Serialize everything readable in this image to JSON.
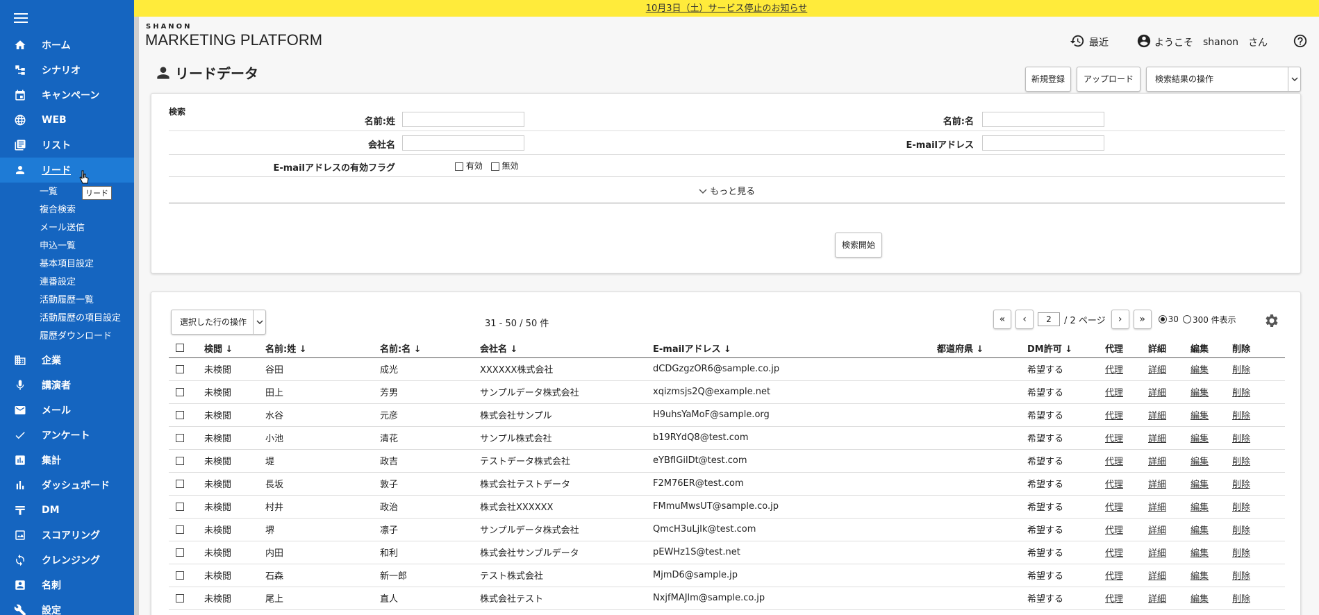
{
  "notice": {
    "text": "10月3日（土）サービス停止のお知らせ"
  },
  "logo": {
    "top": "SHANON",
    "main": "MARKETING PLATFORM"
  },
  "header": {
    "recent": "最近",
    "welcome": "ようこそ",
    "user": "shanon",
    "honorific": "さん"
  },
  "sidebar": {
    "items": [
      {
        "label": "ホーム",
        "icon": "home-icon"
      },
      {
        "label": "シナリオ",
        "icon": "scenario-icon"
      },
      {
        "label": "キャンペーン",
        "icon": "calendar-icon"
      },
      {
        "label": "WEB",
        "icon": "globe-icon"
      },
      {
        "label": "リスト",
        "icon": "list-icon"
      },
      {
        "label": "リード",
        "icon": "person-icon"
      }
    ],
    "sub_items": [
      "一覧",
      "複合検索",
      "メール送信",
      "申込一覧",
      "基本項目設定",
      "連番設定",
      "活動履歴一覧",
      "活動履歴の項目設定",
      "履歴ダウンロード"
    ],
    "items_after": [
      {
        "label": "企業",
        "icon": "building-icon"
      },
      {
        "label": "講演者",
        "icon": "microphone-icon"
      },
      {
        "label": "メール",
        "icon": "mail-icon"
      },
      {
        "label": "アンケート",
        "icon": "check-icon"
      },
      {
        "label": "集計",
        "icon": "report-icon"
      },
      {
        "label": "ダッシュボード",
        "icon": "bar-chart-icon"
      },
      {
        "label": "DM",
        "icon": "dm-icon"
      },
      {
        "label": "スコアリング",
        "icon": "scoring-icon"
      },
      {
        "label": "クレンジング",
        "icon": "cleansing-icon"
      },
      {
        "label": "名刺",
        "icon": "card-icon"
      },
      {
        "label": "設定",
        "icon": "wrench-icon"
      }
    ],
    "tooltip": "リード"
  },
  "page": {
    "title": "リードデータ",
    "new_button": "新規登録",
    "upload_button": "アップロード",
    "results_op": "検索結果の操作"
  },
  "search": {
    "label": "検索",
    "last_name": "名前:姓",
    "first_name": "名前:名",
    "company": "会社名",
    "email": "E-mailアドレス",
    "email_flag": "E-mailアドレスの有効フラグ",
    "valid": "有効",
    "invalid": "無効",
    "more": "もっと見る",
    "submit": "検索開始"
  },
  "results": {
    "rows_op": "選択した行の操作",
    "count": "31 - 50 / 50 件",
    "page_current": "2",
    "page_total": "/ 2 ページ",
    "per_page_30": "30",
    "per_page_300": "300 件表示",
    "columns": [
      "検閲 ↓",
      "名前:姓 ↓",
      "名前:名 ↓",
      "会社名 ↓",
      "E-mailアドレス ↓",
      "都道府県 ↓",
      "DM許可 ↓",
      "代理",
      "詳細",
      "編集",
      "削除"
    ],
    "action_labels": [
      "代理",
      "詳細",
      "編集",
      "削除"
    ],
    "rows": [
      [
        "未検閲",
        "谷田",
        "成光",
        "XXXXXX株式会社",
        "dCDGzgzOR6@sample.co.jp",
        "",
        "希望する"
      ],
      [
        "未検閲",
        "田上",
        "芳男",
        "サンプルデータ株式会社",
        "xqizmsjs2Q@example.net",
        "",
        "希望する"
      ],
      [
        "未検閲",
        "水谷",
        "元彦",
        "株式会社サンプル",
        "H9uhsYaMoF@sample.org",
        "",
        "希望する"
      ],
      [
        "未検閲",
        "小池",
        "清花",
        "サンプル株式会社",
        "b19RYdQ8@test.com",
        "",
        "希望する"
      ],
      [
        "未検閲",
        "堤",
        "政吉",
        "テストデータ株式会社",
        "eYBfIGilDt@test.com",
        "",
        "希望する"
      ],
      [
        "未検閲",
        "長坂",
        "敦子",
        "株式会社テストデータ",
        "F2M76ER@test.com",
        "",
        "希望する"
      ],
      [
        "未検閲",
        "村井",
        "政治",
        "株式会社XXXXXX",
        "FMmuMwsUT@sample.co.jp",
        "",
        "希望する"
      ],
      [
        "未検閲",
        "堺",
        "凛子",
        "サンプルデータ株式会社",
        "QmcH3uLjIk@test.com",
        "",
        "希望する"
      ],
      [
        "未検閲",
        "内田",
        "和利",
        "株式会社サンプルデータ",
        "pEWHz1S@test.net",
        "",
        "希望する"
      ],
      [
        "未検閲",
        "石森",
        "新一郎",
        "テスト株式会社",
        "MjmD6@sample.jp",
        "",
        "希望する"
      ],
      [
        "未検閲",
        "尾上",
        "直人",
        "株式会社テスト",
        "NxjfMAJlm@sample.co.jp",
        "",
        "希望する"
      ]
    ]
  },
  "colors": {
    "sidebar": "#1565c0",
    "sidebar_active": "#1e7bd6",
    "notice": "#ffeb3b"
  }
}
